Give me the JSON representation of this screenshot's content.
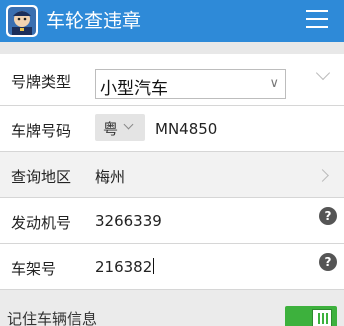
{
  "header": {
    "title": "车轮查违章",
    "app_icon": "app-logo-icon",
    "menu_icon": "menu-icon",
    "color": "#2e8ad8"
  },
  "form": {
    "plate_type": {
      "label": "号牌类型",
      "selected": "小型汽车"
    },
    "plate_number": {
      "label": "车牌号码",
      "prefix": "粤",
      "value": "MN4850"
    },
    "region": {
      "label": "查询地区",
      "value": "梅州"
    },
    "engine_number": {
      "label": "发动机号",
      "value": "3266339",
      "help": "?"
    },
    "frame_number": {
      "label": "车架号",
      "value": "216382",
      "help": "?"
    }
  },
  "remember": {
    "label": "记住车辆信息",
    "enabled": true,
    "color": "#3db13d"
  }
}
